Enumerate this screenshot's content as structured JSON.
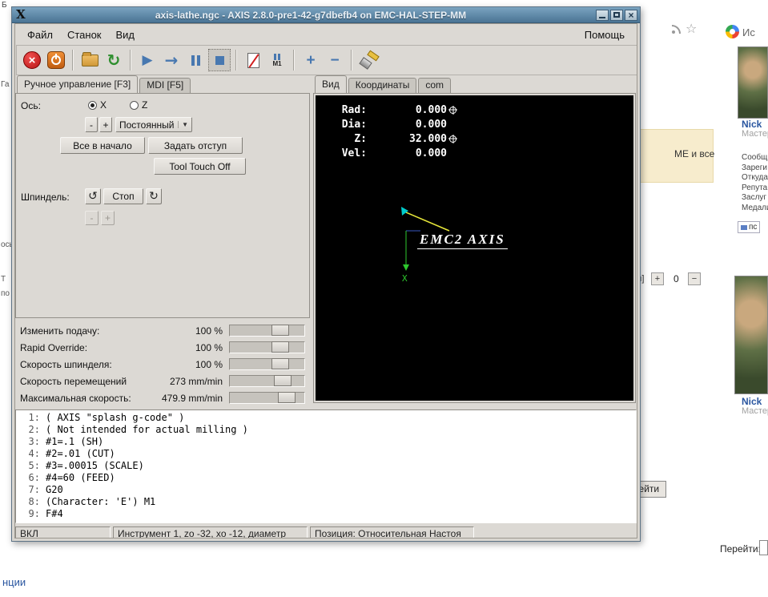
{
  "page": {
    "corner_fragment": "Б",
    "left_fragments": [
      {
        "text": "Га"
      },
      {
        "text": "ось"
      },
      {
        "text": "Т"
      },
      {
        "text": "по"
      }
    ],
    "search_label": "Ис",
    "content_fragment": "МЕ и все",
    "rep_left_fragment": "ля]",
    "rep_plus": "+",
    "rep_count": "0",
    "rep_minus": "−",
    "go_button": "рейти",
    "goto_label": "Перейти:",
    "bottom_link": "нции",
    "users": [
      {
        "name": "Nick",
        "role": "Мастер",
        "pm": "пс",
        "fields": [
          "Сообщ",
          "Зареги",
          "Откуда",
          "Репута",
          "Заслуг",
          "Медали"
        ]
      },
      {
        "name": "Nick",
        "role": "Мастер"
      }
    ]
  },
  "window": {
    "title": "axis-lathe.ngc - AXIS 2.8.0-pre1-42-g7dbefb4 on EMC-HAL-STEP-MM",
    "menu": {
      "file": "Файл",
      "machine": "Станок",
      "view": "Вид",
      "help": "Помощь"
    },
    "toolbar": {
      "m1_label": "M1",
      "zoom_in": "+",
      "zoom_out": "−"
    },
    "tabs": {
      "manual": "Ручное управление [F3]",
      "mdi": "MDI [F5]"
    },
    "manual": {
      "axis_label": "Ось:",
      "axis_x": "X",
      "axis_z": "Z",
      "jog_minus": "-",
      "jog_plus": "+",
      "increment": "Постоянный",
      "home_all": "Все в начало",
      "touch_off": "Задать отступ",
      "tool_touch_off": "Tool Touch Off",
      "spindle_label": "Шпиндель:",
      "spindle_stop": "Стоп",
      "spindle_minus": "-",
      "spindle_plus": "+"
    },
    "overrides": {
      "rows": [
        {
          "label": "Изменить подачу:",
          "value": "100 %"
        },
        {
          "label": "Rapid Override:",
          "value": "100 %"
        },
        {
          "label": "Скорость шпинделя:",
          "value": "100 %"
        },
        {
          "label": "Скорость перемещений",
          "value": "273 mm/min"
        },
        {
          "label": "Максимальная скорость:",
          "value": "479.9 mm/min"
        }
      ]
    },
    "view": {
      "tabs": [
        "Вид",
        "Координаты",
        "com"
      ],
      "dro": [
        {
          "label": "Rad:",
          "value": "0.000"
        },
        {
          "label": "Dia:",
          "value": "0.000"
        },
        {
          "label": "Z:",
          "value": "32.000"
        },
        {
          "label": "Vel:",
          "value": "0.000"
        }
      ],
      "logo": "EMC2 AXIS",
      "axis_x_label": "X"
    },
    "gcode": {
      "lines": [
        {
          "n": "1:",
          "t": "( AXIS \"splash g-code\" )"
        },
        {
          "n": "2:",
          "t": "( Not intended for actual milling )"
        },
        {
          "n": "3:",
          "t": "#1=.1 (SH)"
        },
        {
          "n": "4:",
          "t": "#2=.01 (CUT)"
        },
        {
          "n": "5:",
          "t": "#3=.00015 (SCALE)"
        },
        {
          "n": "6:",
          "t": "#4=60 (FEED)"
        },
        {
          "n": "7:",
          "t": "G20"
        },
        {
          "n": "8:",
          "t": "(Character: 'E') M1"
        },
        {
          "n": "9:",
          "t": "F#4"
        }
      ]
    },
    "status": {
      "power": "ВКЛ",
      "tool": "Инструмент 1, zo -32, xo -12, диаметр",
      "position": "Позиция: Относительная Настоя"
    },
    "colors": {
      "titlebar_top": "#7aa3c0",
      "titlebar_bottom": "#4a7494",
      "path_yellow": "#e8e83a",
      "axis_green": "#2ec82e",
      "tool_cyan": "#00cccc",
      "dro_white": "#ffffff"
    }
  }
}
